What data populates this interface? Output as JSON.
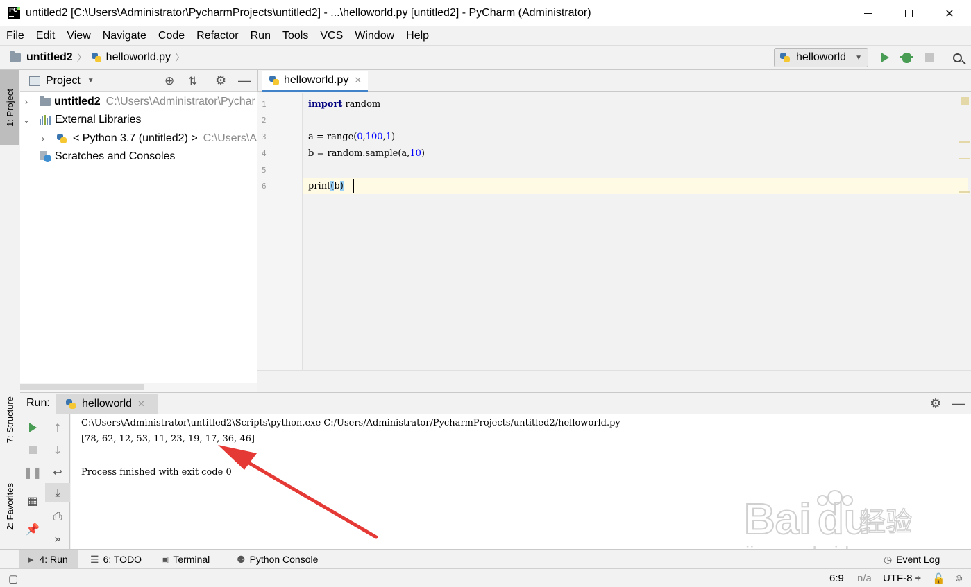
{
  "window": {
    "title": "untitled2 [C:\\Users\\Administrator\\PycharmProjects\\untitled2] - ...\\helloworld.py [untitled2] - PyCharm (Administrator)",
    "app_icon_text": "PC",
    "close_glyph": "✕"
  },
  "menu": [
    "File",
    "Edit",
    "View",
    "Navigate",
    "Code",
    "Refactor",
    "Run",
    "Tools",
    "VCS",
    "Window",
    "Help"
  ],
  "navbar": {
    "project": "untitled2",
    "file": "helloworld.py",
    "run_config": "helloworld"
  },
  "left_stripe": {
    "project_tab": "1: Project",
    "structure_tab": "7: Structure",
    "favorites_tab": "2: Favorites"
  },
  "project_panel": {
    "title": "Project",
    "tree": [
      {
        "label": "untitled2",
        "path": "C:\\Users\\Administrator\\Pychar",
        "arrow": "›"
      },
      {
        "label": "External Libraries",
        "arrow": "⌄"
      },
      {
        "label": "< Python 3.7 (untitled2) >",
        "path": "C:\\Users\\A",
        "arrow": "›"
      },
      {
        "label": "Scratches and Consoles"
      }
    ]
  },
  "editor": {
    "tab": "helloworld.py",
    "line_numbers": [
      "1",
      "2",
      "3",
      "4",
      "5",
      "6"
    ],
    "code": {
      "l1_kw": "import",
      "l1_rest": " random",
      "l3_a": "a = range(",
      "l3_n1": "0",
      "l3_c1": ",",
      "l3_n2": "100",
      "l3_c2": ",",
      "l3_n3": "1",
      "l3_end": ")",
      "l4_a": "b = random.sample(a,",
      "l4_n": "10",
      "l4_end": ")",
      "l6_fn": "print",
      "l6_open": "(",
      "l6_arg": "b",
      "l6_close": ")"
    }
  },
  "run_panel": {
    "label": "Run:",
    "tab": "helloworld",
    "console": {
      "command": "C:\\Users\\Administrator\\untitled2\\Scripts\\python.exe C:/Users/Administrator/PycharmProjects/untitled2/helloworld.py",
      "output": "[78, 62, 12, 53, 11, 23, 19, 17, 36, 46]",
      "finished": "Process finished with exit code 0"
    }
  },
  "bottom_bar": {
    "run": "4: Run",
    "todo": "6: TODO",
    "terminal": "Terminal",
    "python_console": "Python Console",
    "event_log": "Event Log"
  },
  "status_bar": {
    "position": "6:9",
    "na": "n/a",
    "encoding": "UTF-8 ÷"
  },
  "watermark": {
    "brand": "Bai",
    "brand2": "du",
    "cn": "经验",
    "url": "jingyan.baidu.com"
  },
  "colors": {
    "run_green": "#499c54",
    "annotation_red": "#e53935",
    "accent_blue": "#4083c9"
  }
}
